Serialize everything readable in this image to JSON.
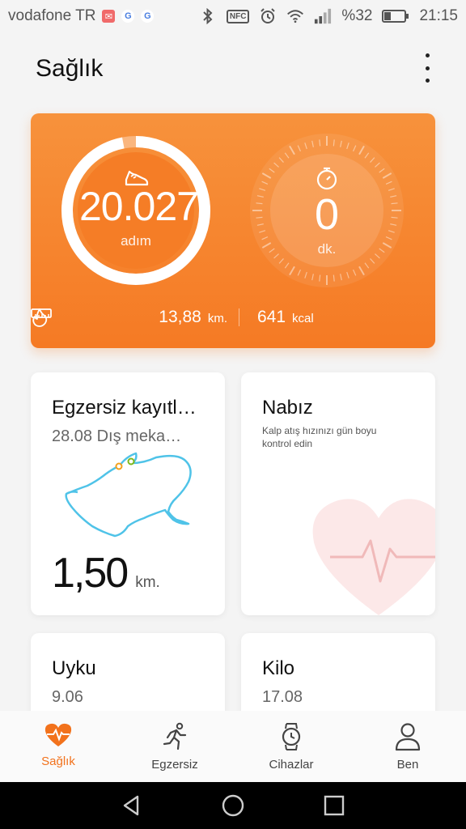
{
  "status_bar": {
    "carrier": "vodafone TR",
    "battery": "%32",
    "time": "21:15",
    "nfc_label": "NFC",
    "icons": [
      "mail-icon",
      "google-icon",
      "google-icon",
      "bluetooth-icon",
      "nfc-icon",
      "alarm-icon",
      "wifi-icon",
      "signal-icon",
      "battery-icon"
    ]
  },
  "header": {
    "title": "Sağlık"
  },
  "activity": {
    "steps_value": "20.027",
    "steps_unit": "adım",
    "steps_progress": 0.97,
    "minutes_value": "0",
    "minutes_unit": "dk.",
    "distance_value": "13,88",
    "distance_unit": "km.",
    "calories_value": "641",
    "calories_unit": "kcal"
  },
  "cards": {
    "exercise": {
      "title": "Egzersiz kayıtl…",
      "subtitle": "28.08 Dış meka…",
      "distance_value": "1,50",
      "distance_unit": "km."
    },
    "heart": {
      "title": "Nabız",
      "description": "Kalp atış hızınızı gün boyu kontrol edin"
    },
    "sleep": {
      "title": "Uyku",
      "date": "9.06"
    },
    "weight": {
      "title": "Kilo",
      "date": "17.08"
    }
  },
  "bottom_nav": {
    "items": [
      {
        "label": "Sağlık",
        "icon": "heart-pulse-icon",
        "active": true
      },
      {
        "label": "Egzersiz",
        "icon": "running-icon",
        "active": false
      },
      {
        "label": "Cihazlar",
        "icon": "watch-icon",
        "active": false
      },
      {
        "label": "Ben",
        "icon": "person-icon",
        "active": false
      }
    ]
  },
  "colors": {
    "accent": "#f57a24",
    "accent_light": "#f7923c",
    "route": "#4fc3e8",
    "heart_pale": "#fbe4e4"
  }
}
